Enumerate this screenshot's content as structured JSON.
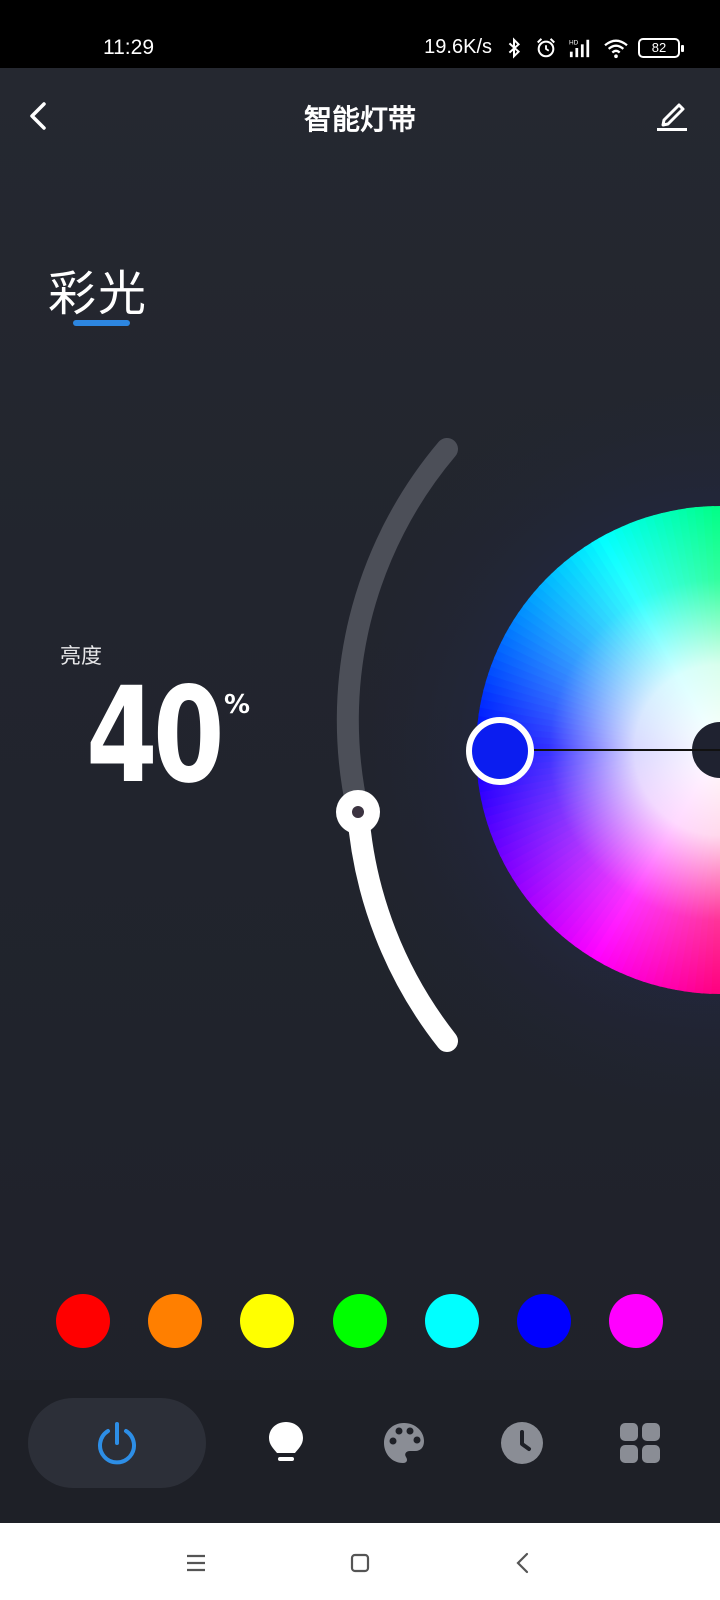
{
  "status_bar": {
    "time": "11:29",
    "speed": "19.6K/s",
    "battery": "82"
  },
  "header": {
    "title": "智能灯带"
  },
  "mode": {
    "label": "彩光"
  },
  "brightness": {
    "label": "亮度",
    "value": "40",
    "unit": "%",
    "level": 0.4
  },
  "color_wheel": {
    "selected_color": "#0b1df0"
  },
  "presets": [
    {
      "name": "red",
      "color": "#ff0000"
    },
    {
      "name": "orange",
      "color": "#ff7f00"
    },
    {
      "name": "yellow",
      "color": "#ffff00"
    },
    {
      "name": "green",
      "color": "#00ff00"
    },
    {
      "name": "cyan",
      "color": "#00ffff"
    },
    {
      "name": "blue",
      "color": "#0000ff"
    },
    {
      "name": "magenta",
      "color": "#ff00ff"
    }
  ],
  "bottom_nav": {
    "items": [
      {
        "icon": "power-icon",
        "active": true,
        "color": "#2d8ee6"
      },
      {
        "icon": "bulb-icon",
        "active": false,
        "color": "#ffffff"
      },
      {
        "icon": "palette-icon",
        "active": false,
        "color": "#8a8d95"
      },
      {
        "icon": "clock-icon",
        "active": false,
        "color": "#8a8d95"
      },
      {
        "icon": "grid-icon",
        "active": false,
        "color": "#8a8d95"
      }
    ]
  },
  "system_nav": {
    "items": [
      {
        "icon": "menu-icon"
      },
      {
        "icon": "home-icon"
      },
      {
        "icon": "back-nav-icon"
      }
    ]
  }
}
